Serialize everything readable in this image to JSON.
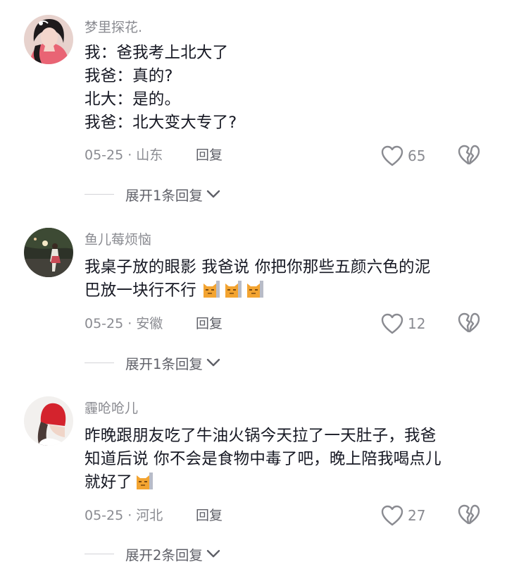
{
  "comments": [
    {
      "username": "梦里探花.",
      "lines": [
        "我：爸我考上北大了",
        "我爸：真的?",
        "北大：是的。",
        "我爸：北大变大专了?"
      ],
      "date": "05-25",
      "location": "山东",
      "reply_label": "回复",
      "likes": "65",
      "expand_label": "展开1条回复"
    },
    {
      "username": "鱼儿莓烦恼",
      "lines": [
        "我桌子放的眼影  我爸说 你把你那些五颜六色的泥",
        "巴放一块行不行"
      ],
      "emoji": "cat-emoji",
      "date": "05-25",
      "location": "安徽",
      "reply_label": "回复",
      "likes": "12",
      "expand_label": "展开1条回复"
    },
    {
      "username": "霾呛呛儿",
      "lines": [
        "昨晚跟朋友吃了牛油火锅今天拉了一天肚子，我爸",
        "知道后说 你不会是食物中毒了吧，晚上陪我喝点儿",
        "就好了"
      ],
      "emoji": "cat-emoji",
      "date": "05-25",
      "location": "河北",
      "reply_label": "回复",
      "likes": "27",
      "expand_label": "展开2条回复"
    }
  ],
  "icons": {
    "like": "heart-outline-icon",
    "dislike": "broken-heart-icon",
    "expand": "chevron-down-icon"
  },
  "colors": {
    "text": "#161823",
    "secondary": "#8a8b91",
    "reply": "#5f6068",
    "emoji": "#f3a431"
  }
}
